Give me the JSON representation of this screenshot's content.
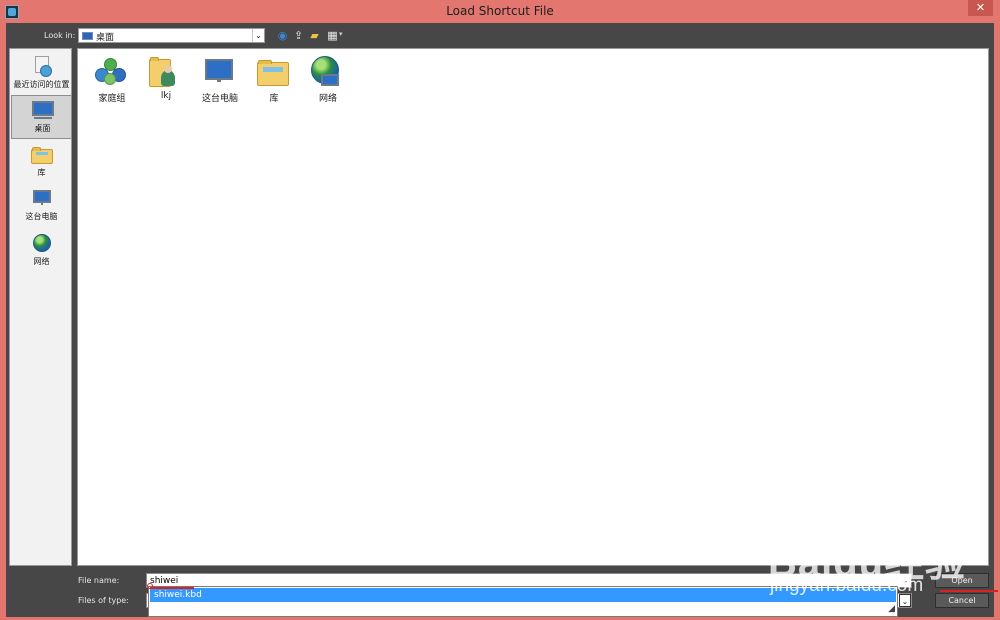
{
  "window": {
    "title": "Load Shortcut File",
    "close_glyph": "✕"
  },
  "toolbar": {
    "look_in_label": "Look in:",
    "look_in_value": "桌面",
    "icons": [
      "back-icon",
      "up-folder-icon",
      "new-folder-icon",
      "view-menu-icon"
    ]
  },
  "places": [
    {
      "label": "最近访问的位置",
      "icon": "recent-places-icon"
    },
    {
      "label": "桌面",
      "icon": "desktop-icon",
      "selected": true
    },
    {
      "label": "库",
      "icon": "libraries-icon"
    },
    {
      "label": "这台电脑",
      "icon": "this-pc-icon"
    },
    {
      "label": "网络",
      "icon": "network-icon"
    }
  ],
  "files": [
    {
      "label": "家庭组",
      "icon": "homegroup-icon"
    },
    {
      "label": "lkj",
      "icon": "user-folder-icon"
    },
    {
      "label": "这台电脑",
      "icon": "this-pc-icon"
    },
    {
      "label": "库",
      "icon": "libraries-icon"
    },
    {
      "label": "网络",
      "icon": "network-icon"
    }
  ],
  "form": {
    "file_name_label": "File name:",
    "file_name_value": "shiwei",
    "files_of_type_label": "Files of type:",
    "files_of_type_value": "",
    "autocomplete_item": "shiwei.kbd"
  },
  "buttons": {
    "open": "Open",
    "cancel": "Cancel"
  },
  "watermark": {
    "line1": "Baidu经验",
    "line2": "jingyan.baidu.com"
  },
  "colors": {
    "title_bar": "#e3766e",
    "client_bg": "#474747",
    "selection": "#3399ff",
    "annotation": "#e02020"
  }
}
